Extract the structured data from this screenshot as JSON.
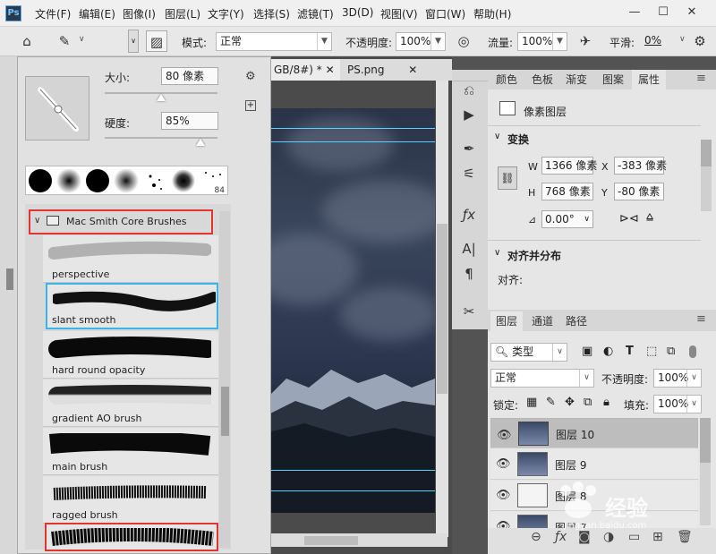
{
  "app": {
    "logo": "Ps"
  },
  "menu": [
    "文件(F)",
    "编辑(E)",
    "图像(I)",
    "图层(L)",
    "文字(Y)",
    "选择(S)",
    "滤镜(T)",
    "3D(D)",
    "视图(V)",
    "窗口(W)",
    "帮助(H)"
  ],
  "window_controls": {
    "minimize": "—",
    "maximize": "☐",
    "close": "✕"
  },
  "options": {
    "brush_size": "80",
    "mode_label": "模式:",
    "mode_value": "正常",
    "opacity_label": "不透明度:",
    "opacity_value": "100%",
    "flow_label": "流量:",
    "flow_value": "100%",
    "smooth_label": "平滑:",
    "smooth_value": "0%"
  },
  "doc_tabs": [
    "GB/8#) *",
    "PS.png"
  ],
  "brush_panel": {
    "size_label": "大小:",
    "size_value": "80 像素",
    "hardness_label": "硬度:",
    "hardness_value": "85%",
    "size_slider_fraction": 0.5,
    "hardness_slider_fraction": 0.85,
    "preset_extra": "84",
    "group_name": "Mac Smith Core Brushes",
    "brushes": [
      "perspective",
      "slant smooth",
      "hard round opacity",
      "gradient AO brush",
      "main brush",
      "ragged brush",
      ""
    ]
  },
  "right_panels": {
    "tabs": [
      "颜色",
      "色板",
      "渐变",
      "图案",
      "属性"
    ],
    "active_tab": "属性",
    "layer_type": "像素图层",
    "transform_title": "变换",
    "w_label": "W",
    "w_value": "1366 像素",
    "x_label": "X",
    "x_value": "-383 像素",
    "h_label": "H",
    "h_value": "768 像素",
    "y_label": "Y",
    "y_value": "-80 像素",
    "angle_value": "0.00°",
    "align_title": "对齐并分布",
    "align_label": "对齐:"
  },
  "layers_panel": {
    "tabs": [
      "图层",
      "通道",
      "路径"
    ],
    "filter_label": "类型",
    "blend_mode": "正常",
    "opacity_label": "不透明度:",
    "opacity_value": "100%",
    "lock_label": "锁定:",
    "fill_label": "填充:",
    "fill_value": "100%",
    "layers": [
      "图层 10",
      "图层 9",
      "图层 8",
      "图层 7"
    ]
  },
  "watermark": {
    "text": "经验",
    "url": "jingyan.baidu.com"
  },
  "colors": {
    "highlight_red": "#e33434",
    "selection_blue": "#38b6e8",
    "guide_cyan": "#5ad2ff"
  }
}
